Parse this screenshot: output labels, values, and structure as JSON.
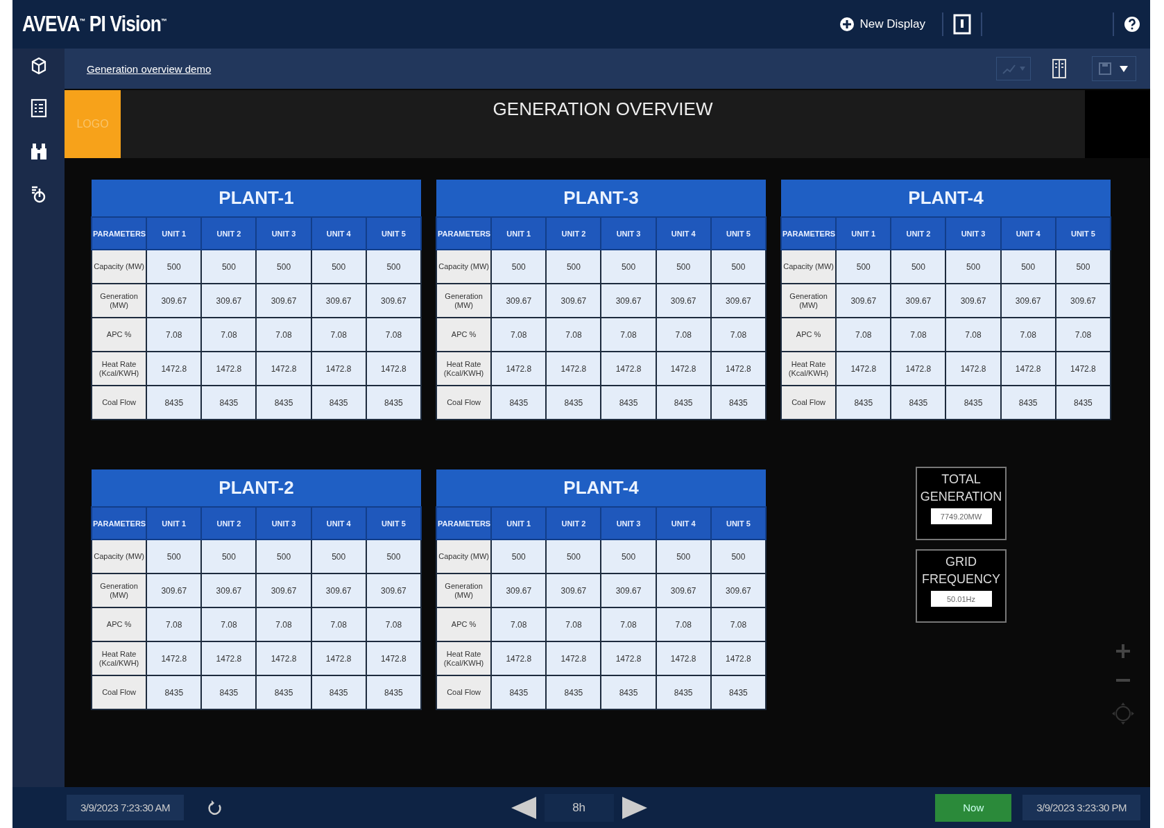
{
  "app_bar": {
    "title": "AVEVA$^{™}$ PI Vision$^{™}$",
    "new_display": "New Display"
  },
  "toolbar": {
    "display_name": "Generation overview demo"
  },
  "header": {
    "logo": "LOGO",
    "title": "GENERATION OVERVIEW"
  },
  "plants": [
    {
      "title": "PLANT-1",
      "columns": [
        "PARAMETERS",
        "UNIT 1",
        "UNIT 2",
        "UNIT 3",
        "UNIT 4",
        "UNIT 5"
      ],
      "rows": [
        {
          "parameter": "Capacity (MW)",
          "values": [
            "500",
            "500",
            "500",
            "500",
            "500"
          ]
        },
        {
          "parameter": "Generation (MW)",
          "values": [
            "309.67",
            "309.67",
            "309.67",
            "309.67",
            "309.67"
          ]
        },
        {
          "parameter": "APC %",
          "values": [
            "7.08",
            "7.08",
            "7.08",
            "7.08",
            "7.08"
          ]
        },
        {
          "parameter": "Heat Rate (Kcal/KWH)",
          "values": [
            "1472.8",
            "1472.8",
            "1472.8",
            "1472.8",
            "1472.8"
          ]
        },
        {
          "parameter": "Coal Flow",
          "values": [
            "8435",
            "8435",
            "8435",
            "8435",
            "8435"
          ]
        }
      ]
    },
    {
      "title": "PLANT-3",
      "columns": [
        "PARAMETERS",
        "UNIT 1",
        "UNIT 2",
        "UNIT 3",
        "UNIT 4",
        "UNIT 5"
      ],
      "rows": [
        {
          "parameter": "Capacity (MW)",
          "values": [
            "500",
            "500",
            "500",
            "500",
            "500"
          ]
        },
        {
          "parameter": "Generation (MW)",
          "values": [
            "309.67",
            "309.67",
            "309.67",
            "309.67",
            "309.67"
          ]
        },
        {
          "parameter": "APC %",
          "values": [
            "7.08",
            "7.08",
            "7.08",
            "7.08",
            "7.08"
          ]
        },
        {
          "parameter": "Heat Rate (Kcal/KWH)",
          "values": [
            "1472.8",
            "1472.8",
            "1472.8",
            "1472.8",
            "1472.8"
          ]
        },
        {
          "parameter": "Coal Flow",
          "values": [
            "8435",
            "8435",
            "8435",
            "8435",
            "8435"
          ]
        }
      ]
    },
    {
      "title": "PLANT-4",
      "columns": [
        "PARAMETERS",
        "UNIT 1",
        "UNIT 2",
        "UNIT 3",
        "UNIT 4",
        "UNIT 5"
      ],
      "rows": [
        {
          "parameter": "Capacity (MW)",
          "values": [
            "500",
            "500",
            "500",
            "500",
            "500"
          ]
        },
        {
          "parameter": "Generation (MW)",
          "values": [
            "309.67",
            "309.67",
            "309.67",
            "309.67",
            "309.67"
          ]
        },
        {
          "parameter": "APC %",
          "values": [
            "7.08",
            "7.08",
            "7.08",
            "7.08",
            "7.08"
          ]
        },
        {
          "parameter": "Heat Rate (Kcal/KWH)",
          "values": [
            "1472.8",
            "1472.8",
            "1472.8",
            "1472.8",
            "1472.8"
          ]
        },
        {
          "parameter": "Coal Flow",
          "values": [
            "8435",
            "8435",
            "8435",
            "8435",
            "8435"
          ]
        }
      ]
    },
    {
      "title": "PLANT-2",
      "columns": [
        "PARAMETERS",
        "UNIT 1",
        "UNIT 2",
        "UNIT 3",
        "UNIT 4",
        "UNIT 5"
      ],
      "rows": [
        {
          "parameter": "Capacity (MW)",
          "values": [
            "500",
            "500",
            "500",
            "500",
            "500"
          ]
        },
        {
          "parameter": "Generation (MW)",
          "values": [
            "309.67",
            "309.67",
            "309.67",
            "309.67",
            "309.67"
          ]
        },
        {
          "parameter": "APC %",
          "values": [
            "7.08",
            "7.08",
            "7.08",
            "7.08",
            "7.08"
          ]
        },
        {
          "parameter": "Heat Rate (Kcal/KWH)",
          "values": [
            "1472.8",
            "1472.8",
            "1472.8",
            "1472.8",
            "1472.8"
          ]
        },
        {
          "parameter": "Coal Flow",
          "values": [
            "8435",
            "8435",
            "8435",
            "8435",
            "8435"
          ]
        }
      ]
    },
    {
      "title": "PLANT-4",
      "columns": [
        "PARAMETERS",
        "UNIT 1",
        "UNIT 2",
        "UNIT 3",
        "UNIT 4",
        "UNIT 5"
      ],
      "rows": [
        {
          "parameter": "Capacity (MW)",
          "values": [
            "500",
            "500",
            "500",
            "500",
            "500"
          ]
        },
        {
          "parameter": "Generation (MW)",
          "values": [
            "309.67",
            "309.67",
            "309.67",
            "309.67",
            "309.67"
          ]
        },
        {
          "parameter": "APC %",
          "values": [
            "7.08",
            "7.08",
            "7.08",
            "7.08",
            "7.08"
          ]
        },
        {
          "parameter": "Heat Rate (Kcal/KWH)",
          "values": [
            "1472.8",
            "1472.8",
            "1472.8",
            "1472.8",
            "1472.8"
          ]
        },
        {
          "parameter": "Coal Flow",
          "values": [
            "8435",
            "8435",
            "8435",
            "8435",
            "8435"
          ]
        }
      ]
    }
  ],
  "summary": [
    {
      "label": "TOTAL GENERATION",
      "value": "7749.20MW"
    },
    {
      "label": "GRID FREQUENCY",
      "value": "50.01Hz"
    }
  ],
  "time_bar": {
    "start": "3/9/2023 7:23:30 AM",
    "duration": "8h",
    "now": "Now",
    "end": "3/9/2023 3:23:30 PM"
  }
}
